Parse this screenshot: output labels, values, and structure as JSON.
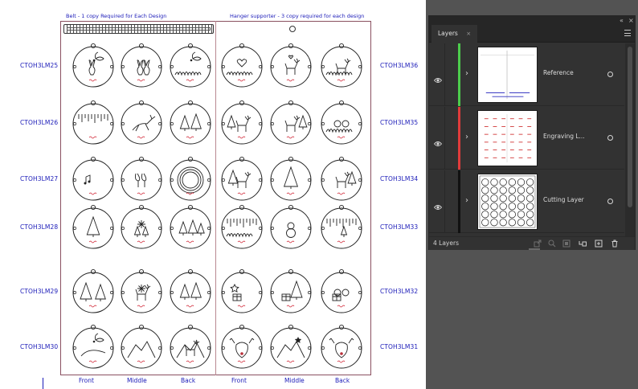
{
  "artboard": {
    "belt_label": "Belt - 1 copy Required for Each Design",
    "hanger_label": "Hanger supporter - 3 copy required for each design",
    "left_rows": [
      "CTOH3LM25",
      "CTOH3LM26",
      "CTOH3LM27",
      "CTOH3LM28",
      "CTOH3LM29",
      "CTOH3LM30"
    ],
    "right_rows": [
      "CTOH3LM36",
      "CTOH3LM35",
      "CTOH3LM34",
      "CTOH3LM33",
      "CTOH3LM32",
      "CTOH3LM31"
    ],
    "columns": [
      "Front",
      "Middle",
      "Back",
      "Front",
      "Middle",
      "Back"
    ],
    "ornament_motifs": [
      [
        "bunny-and-holly",
        "two-bunnies",
        "holly-and-grass",
        "heart-and-branches",
        "deer-and-heart",
        "fawn-in-grass"
      ],
      [
        "icicles",
        "leaping-deer",
        "pine-trees",
        "stag-in-forest",
        "stag-in-trees",
        "grass-and-bells"
      ],
      [
        "music-notes",
        "wine-glasses",
        "wreath-rings",
        "deer-and-pines",
        "single-pine",
        "deer-in-pines"
      ],
      [
        "pine-tree",
        "snowflake-and-trees",
        "pine-forest",
        "frosty-snowscape",
        "snowman",
        "icy-forest"
      ],
      [
        "tree-line",
        "reindeer-and-snowflake",
        "pine-trees",
        "star-and-gift",
        "pine-and-gift",
        "baubles-and-gift"
      ],
      [
        "holly-branch",
        "mountains",
        "reindeer-in-snow",
        "reindeer-face",
        "mountain-and-star",
        "reindeer-face"
      ]
    ],
    "colors": {
      "label_blue": "#1a1ab8",
      "sheet_border": "#8a5060",
      "signature_red": "#d02030"
    }
  },
  "layers_panel": {
    "tab_label": "Layers",
    "tab_close": "×",
    "layers": [
      {
        "name": "Reference",
        "color": "#4ccc4c",
        "thumb": "reference"
      },
      {
        "name": "Engraving L...",
        "color": "#e03b3b",
        "thumb": "engraving"
      },
      {
        "name": "Cutting Layer",
        "color": "#111111",
        "thumb": "cutting"
      }
    ],
    "footer": {
      "count": "4 Layers"
    },
    "icons": [
      "eye-icon",
      "expand-arrow-icon",
      "target-circle-icon",
      "export-icon",
      "search-icon",
      "clipping-mask-icon",
      "sublayer-icon",
      "new-layer-icon",
      "delete-icon",
      "panel-menu-icon"
    ]
  }
}
